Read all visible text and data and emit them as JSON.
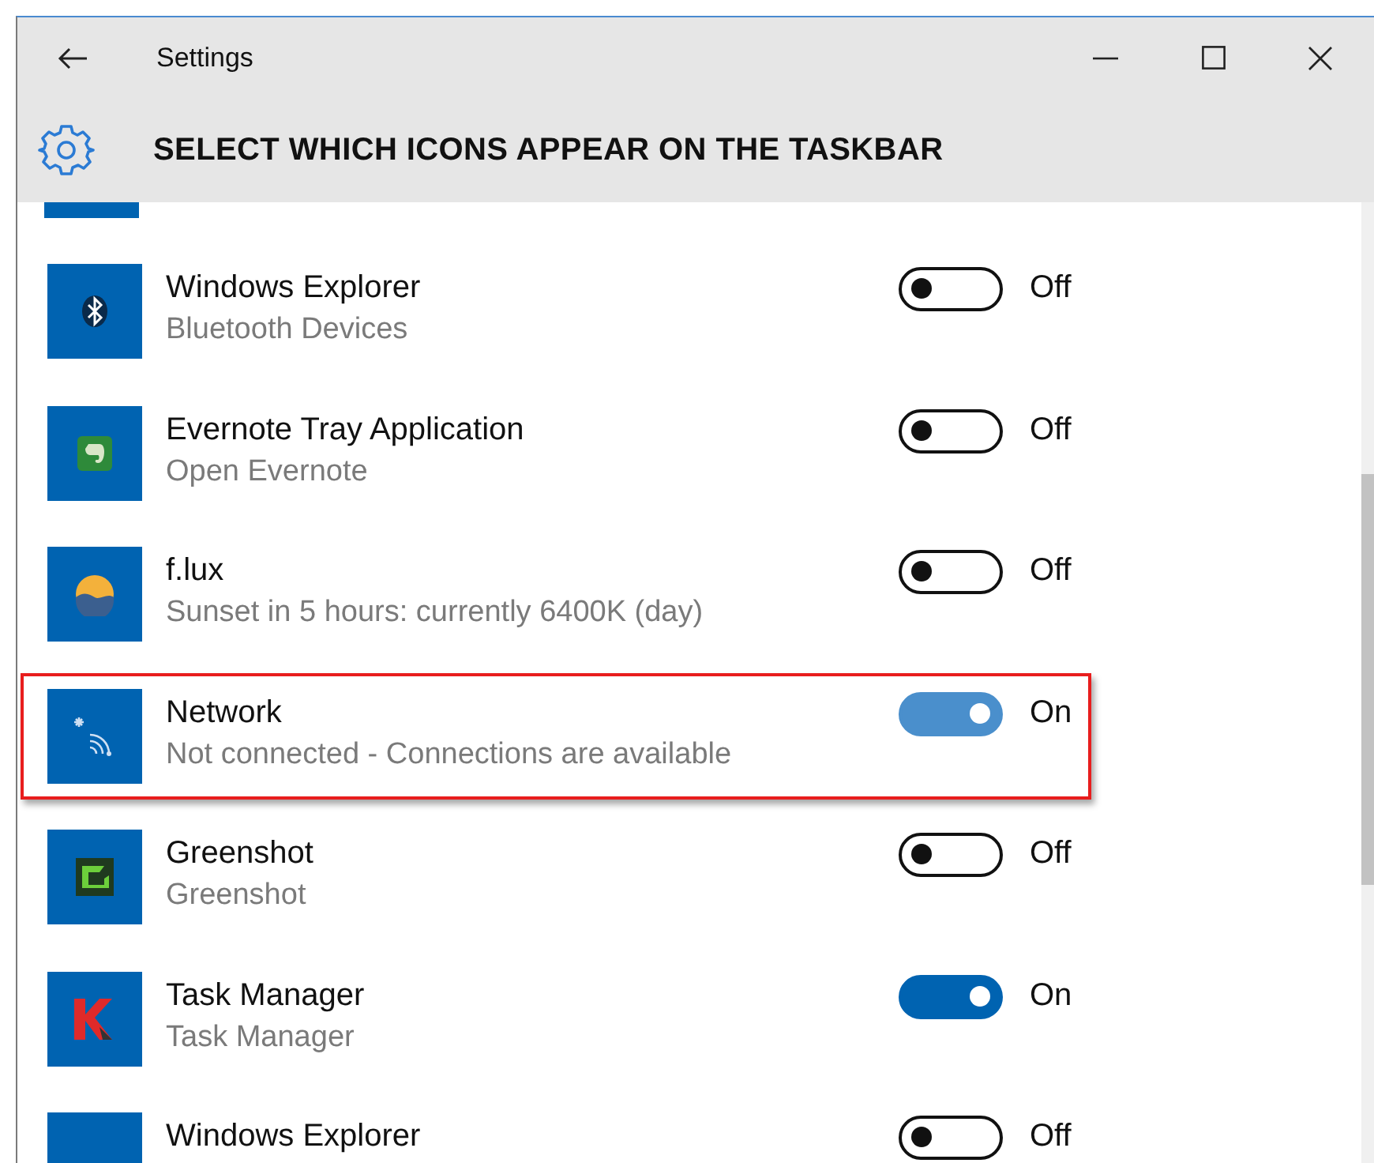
{
  "window": {
    "title": "Settings"
  },
  "header": {
    "title": "SELECT WHICH ICONS APPEAR ON THE TASKBAR"
  },
  "items": [
    {
      "name": "Windows Explorer",
      "detail": "Bluetooth Devices",
      "on": false,
      "state_label": "Off",
      "highlighted": false
    },
    {
      "name": "Evernote Tray Application",
      "detail": "Open Evernote",
      "on": false,
      "state_label": "Off",
      "highlighted": false
    },
    {
      "name": "f.lux",
      "detail": "Sunset in 5 hours: currently 6400K (day)",
      "on": false,
      "state_label": "Off",
      "highlighted": false
    },
    {
      "name": "Network",
      "detail": "Not connected - Connections are available",
      "on": true,
      "state_label": "On",
      "highlighted": true
    },
    {
      "name": "Greenshot",
      "detail": "Greenshot",
      "on": false,
      "state_label": "Off",
      "highlighted": false
    },
    {
      "name": "Task Manager",
      "detail": "Task Manager",
      "on": true,
      "state_label": "On",
      "highlighted": false
    },
    {
      "name": "Windows Explorer",
      "on": false,
      "state_label": "Off",
      "highlighted": false
    }
  ]
}
